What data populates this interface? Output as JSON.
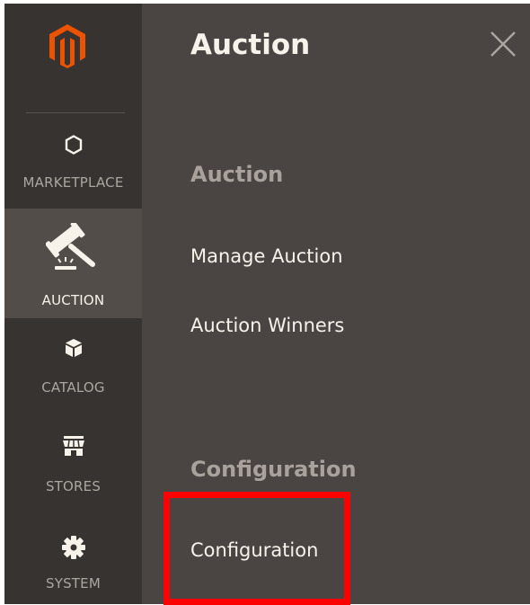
{
  "sidebar": {
    "logo_icon": "magento-logo",
    "items": [
      {
        "label": "MARKETPLACE",
        "icon": "hexagon-icon"
      },
      {
        "label": "AUCTION",
        "icon": "gavel-icon",
        "active": true
      },
      {
        "label": "CATALOG",
        "icon": "box-icon"
      },
      {
        "label": "STORES",
        "icon": "store-icon"
      },
      {
        "label": "SYSTEM",
        "icon": "gear-icon"
      }
    ]
  },
  "panel": {
    "title": "Auction",
    "close_icon": "close-icon",
    "sections": [
      {
        "title": "Auction",
        "links": [
          "Manage Auction",
          "Auction Winners"
        ]
      },
      {
        "title": "Configuration",
        "links": [
          "Configuration"
        ]
      }
    ]
  },
  "colors": {
    "sidebar_bg": "#373330",
    "sidebar_active_bg": "#524d49",
    "panel_bg": "#4a4542",
    "logo_orange": "#eb5202",
    "highlight": "#ff0000"
  }
}
